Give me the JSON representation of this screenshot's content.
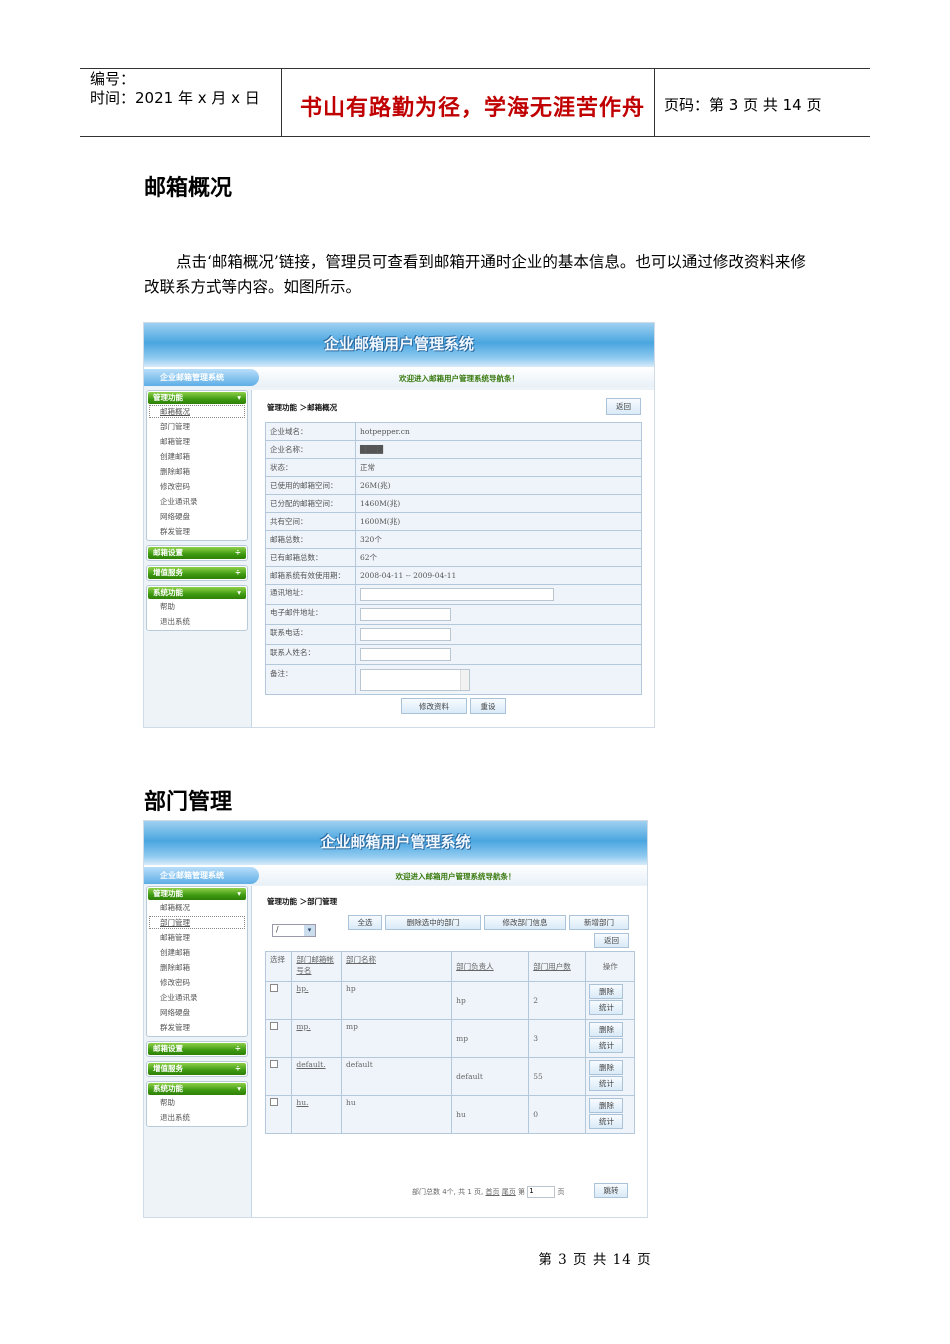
{
  "header": {
    "number_label": "编号：",
    "time_label": "时间：2021 年 x 月 x 日",
    "motto": "书山有路勤为径，学海无涯苦作舟",
    "page_label": "页码：第 3 页  共 14 页"
  },
  "section1": {
    "title": "邮箱概况",
    "paragraph": "点击‘邮箱概况’链接，管理员可查看到邮箱开通时企业的基本信息。也可以通过修改资料来修改联系方式等内容。如图所示。"
  },
  "app": {
    "banner_title": "企业邮箱用户管理系统",
    "nav_title": "企业邮箱管理系统",
    "welcome": "欢迎进入邮箱用户管理系统导航条！",
    "sidebar": {
      "groups": [
        {
          "title": "管理功能",
          "arrow": "▾",
          "items": [
            "邮箱概况",
            "部门管理",
            "邮箱管理",
            "创建邮箱",
            "删除邮箱",
            "修改密码",
            "企业通讯录",
            "网络硬盘",
            "群发管理"
          ]
        },
        {
          "title": "邮箱设置",
          "arrow": "÷",
          "items": []
        },
        {
          "title": "增值服务",
          "arrow": "÷",
          "items": []
        },
        {
          "title": "系统功能",
          "arrow": "▾",
          "items": [
            "帮助",
            "退出系统"
          ]
        }
      ]
    }
  },
  "shot1": {
    "breadcrumb": "管理功能 ＞邮箱概况",
    "back_button": "返回",
    "fields": [
      {
        "label": "企业域名：",
        "value": "hotpepper.cn"
      },
      {
        "label": "企业名称：",
        "value": "████"
      },
      {
        "label": "状态：",
        "value": "正常"
      },
      {
        "label": "已使用的邮箱空间：",
        "value": "26M(兆)"
      },
      {
        "label": "已分配的邮箱空间：",
        "value": "1460M(兆)"
      },
      {
        "label": "共有空间：",
        "value": "1600M(兆)"
      },
      {
        "label": "邮箱总数：",
        "value": "320个"
      },
      {
        "label": "已有邮箱总数：",
        "value": "62个"
      },
      {
        "label": "邮箱系统有效使用期：",
        "value": "2008-04-11 -- 2009-04-11"
      }
    ],
    "inputs": [
      {
        "label": "通讯地址：",
        "value": ""
      },
      {
        "label": "电子邮件地址：",
        "value": ""
      },
      {
        "label": "联系电话：",
        "value": ""
      },
      {
        "label": "联系人姓名：",
        "value": ""
      }
    ],
    "remark_label": "备注：",
    "submit_button": "修改资料",
    "reset_button": "重设"
  },
  "section2": {
    "title": "部门管理"
  },
  "shot2": {
    "breadcrumb": "管理功能 ＞部门管理",
    "select_value": "/",
    "buttons": [
      "全选",
      "删除选中的部门",
      "修改部门信息",
      "新增部门"
    ],
    "back_button": "返回",
    "columns": [
      "选择",
      "部门邮箱帐号名",
      "部门名称",
      "部门负责人",
      "部门用户数",
      "操作"
    ],
    "rows": [
      {
        "account": "hp.",
        "name": "hp",
        "manager": "hp",
        "users": "2"
      },
      {
        "account": "mp.",
        "name": "mp",
        "manager": "mp",
        "users": "3"
      },
      {
        "account": "default.",
        "name": "default",
        "manager": "default",
        "users": "55"
      },
      {
        "account": "hu.",
        "name": "hu",
        "manager": "hu",
        "users": "0"
      }
    ],
    "delete_label": "删除",
    "stats_label": "统计",
    "pager": {
      "summary": "部门总数 4个, 共 1 页,",
      "first": "首页",
      "last": "尾页",
      "page_prefix": "第",
      "page_value": "1",
      "page_suffix": "页",
      "jump": "跳转"
    }
  },
  "footer": "第 3 页 共 14 页"
}
